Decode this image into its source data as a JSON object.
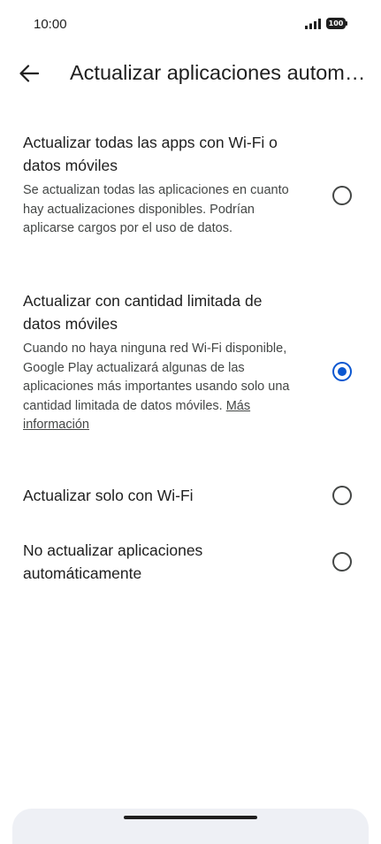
{
  "status_bar": {
    "time": "10:00",
    "battery": "100",
    "icons": [
      "signal-icon",
      "battery-icon"
    ]
  },
  "app_bar": {
    "back_icon": "arrow-back-icon",
    "title": "Actualizar aplicaciones automáticamente"
  },
  "options": [
    {
      "title": "Actualizar todas las apps con Wi-Fi o datos móviles",
      "description": "Se actualizan todas las aplicaciones en cuanto hay actualizaciones disponibles. Podrían aplicarse cargos por el uso de datos.",
      "selected": false
    },
    {
      "title": "Actualizar con cantidad limitada de datos móviles",
      "description": "Cuando no haya ninguna red Wi-Fi disponible, Google Play actualizará algunas de las aplicaciones más importantes usando solo una cantidad limitada de datos móviles.",
      "link": "Más información",
      "selected": true
    },
    {
      "title": "Actualizar solo con Wi-Fi",
      "selected": false
    },
    {
      "title": "No actualizar aplicaciones automáticamente",
      "selected": false
    }
  ],
  "colors": {
    "accent": "#0b57d0",
    "text_primary": "#1f1f1f",
    "text_secondary": "#444746",
    "background": "#ffffff"
  }
}
